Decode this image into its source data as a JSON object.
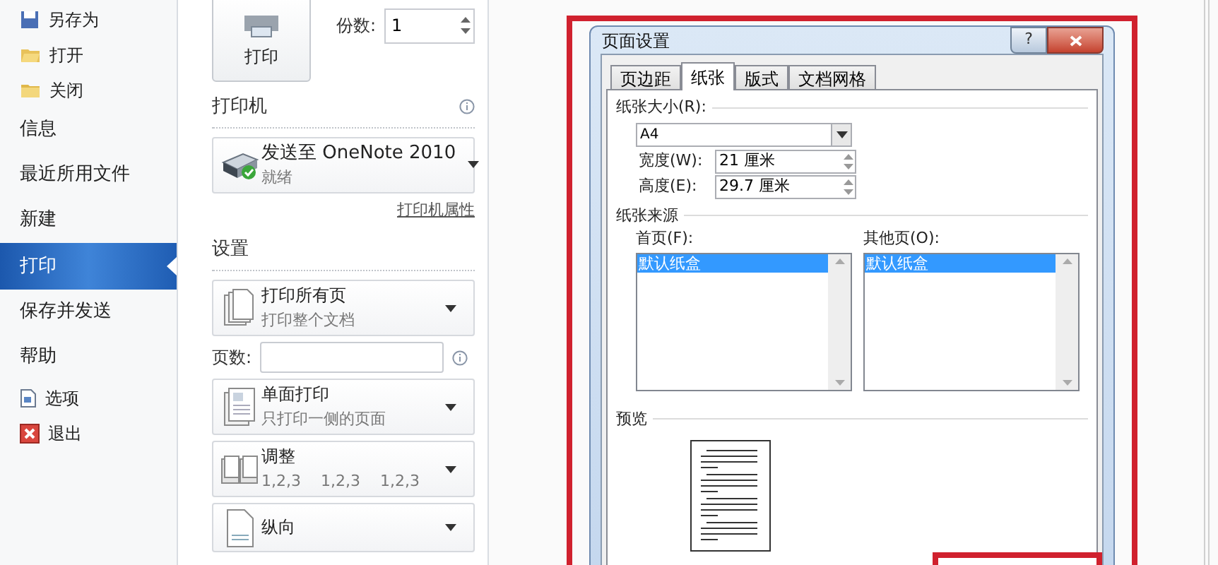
{
  "sidebar": {
    "items": [
      {
        "label": "另存为",
        "kind": "save",
        "selected": false
      },
      {
        "label": "打开",
        "kind": "open",
        "selected": false
      },
      {
        "label": "关闭",
        "kind": "close",
        "selected": false
      },
      {
        "label": "信息",
        "kind": "plain",
        "selected": false
      },
      {
        "label": "最近所用文件",
        "kind": "plain",
        "selected": false
      },
      {
        "label": "新建",
        "kind": "plain",
        "selected": false
      },
      {
        "label": "打印",
        "kind": "plain",
        "selected": true
      },
      {
        "label": "保存并发送",
        "kind": "plain",
        "selected": false
      },
      {
        "label": "帮助",
        "kind": "plain",
        "selected": false
      },
      {
        "label": "选项",
        "kind": "options",
        "selected": false
      },
      {
        "label": "退出",
        "kind": "exit",
        "selected": false
      }
    ]
  },
  "print_panel": {
    "print_button": "打印",
    "copies": {
      "label": "份数:",
      "value": "1"
    },
    "printer": {
      "heading": "打印机",
      "name": "发送至 OneNote 2010",
      "status": "就绪",
      "properties_link": "打印机属性"
    },
    "settings": {
      "heading": "设置",
      "items": [
        {
          "kind": "pages",
          "title": "打印所有页",
          "subtitle": "打印整个文档"
        },
        {
          "kind": "range",
          "label": "页数:"
        },
        {
          "kind": "sides",
          "title": "单面打印",
          "subtitle": "只打印一侧的页面"
        },
        {
          "kind": "collate",
          "title": "调整",
          "sequence": [
            "1,2,3",
            "1,2,3",
            "1,2,3"
          ]
        },
        {
          "kind": "orientation",
          "title": "纵向"
        }
      ]
    }
  },
  "dialog": {
    "title": "页面设置",
    "help_button": "?",
    "tabs": [
      {
        "label": "页边距",
        "selected": false
      },
      {
        "label": "纸张",
        "selected": true
      },
      {
        "label": "版式",
        "selected": false
      },
      {
        "label": "文档网格",
        "selected": false
      }
    ],
    "paper_size": {
      "label": "纸张大小(R):",
      "value": "A4"
    },
    "width": {
      "label": "宽度(W):",
      "value": "21 厘米"
    },
    "height": {
      "label": "高度(E):",
      "value": "29.7 厘米"
    },
    "paper_source": {
      "heading": "纸张来源",
      "first_page": {
        "label": "首页(F):",
        "items": [
          {
            "label": "默认纸盒",
            "selected": true
          }
        ]
      },
      "other_pages": {
        "label": "其他页(O):",
        "items": [
          {
            "label": "默认纸盒",
            "selected": true
          }
        ]
      }
    },
    "preview": {
      "heading": "预览"
    }
  }
}
